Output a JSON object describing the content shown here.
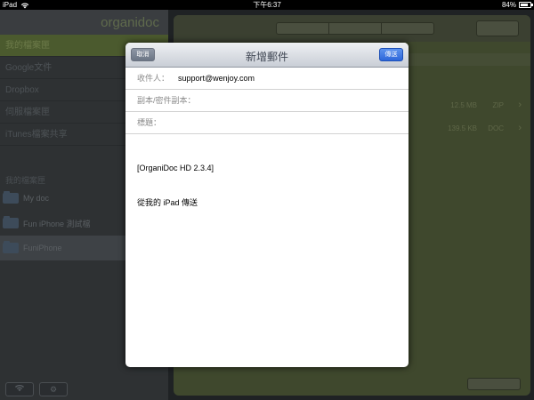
{
  "status_bar": {
    "device": "iPad",
    "time": "下午6:37",
    "battery": "84%",
    "battery_level": 0.84
  },
  "sidebar": {
    "brand": "organidoc",
    "items": [
      {
        "label": "我的檔案匣"
      },
      {
        "label": "Google文件"
      },
      {
        "label": "Dropbox"
      },
      {
        "label": "伺服檔案匣"
      },
      {
        "label": "iTunes檔案共享"
      }
    ],
    "section_title": "我的檔案匣",
    "files": [
      {
        "name": "My doc"
      },
      {
        "name": "Fun iPhone 測試檔"
      },
      {
        "name": "FuniPhone"
      }
    ]
  },
  "main": {
    "rows": [
      {
        "size": "12.5 MB",
        "type": "ZIP"
      },
      {
        "size": "139.5 KB",
        "type": "DOC"
      }
    ]
  },
  "compose": {
    "title": "新增郵件",
    "cancel": "取消",
    "send": "傳送",
    "to_label": "收件人：",
    "to_value": "support@wenjoy.com",
    "cc_label": "副本/密件副本：",
    "subject_label": "標題：",
    "body_line1": "[OrganiDoc HD 2.3.4]",
    "body_line2": "從我的 iPad 傳送"
  }
}
